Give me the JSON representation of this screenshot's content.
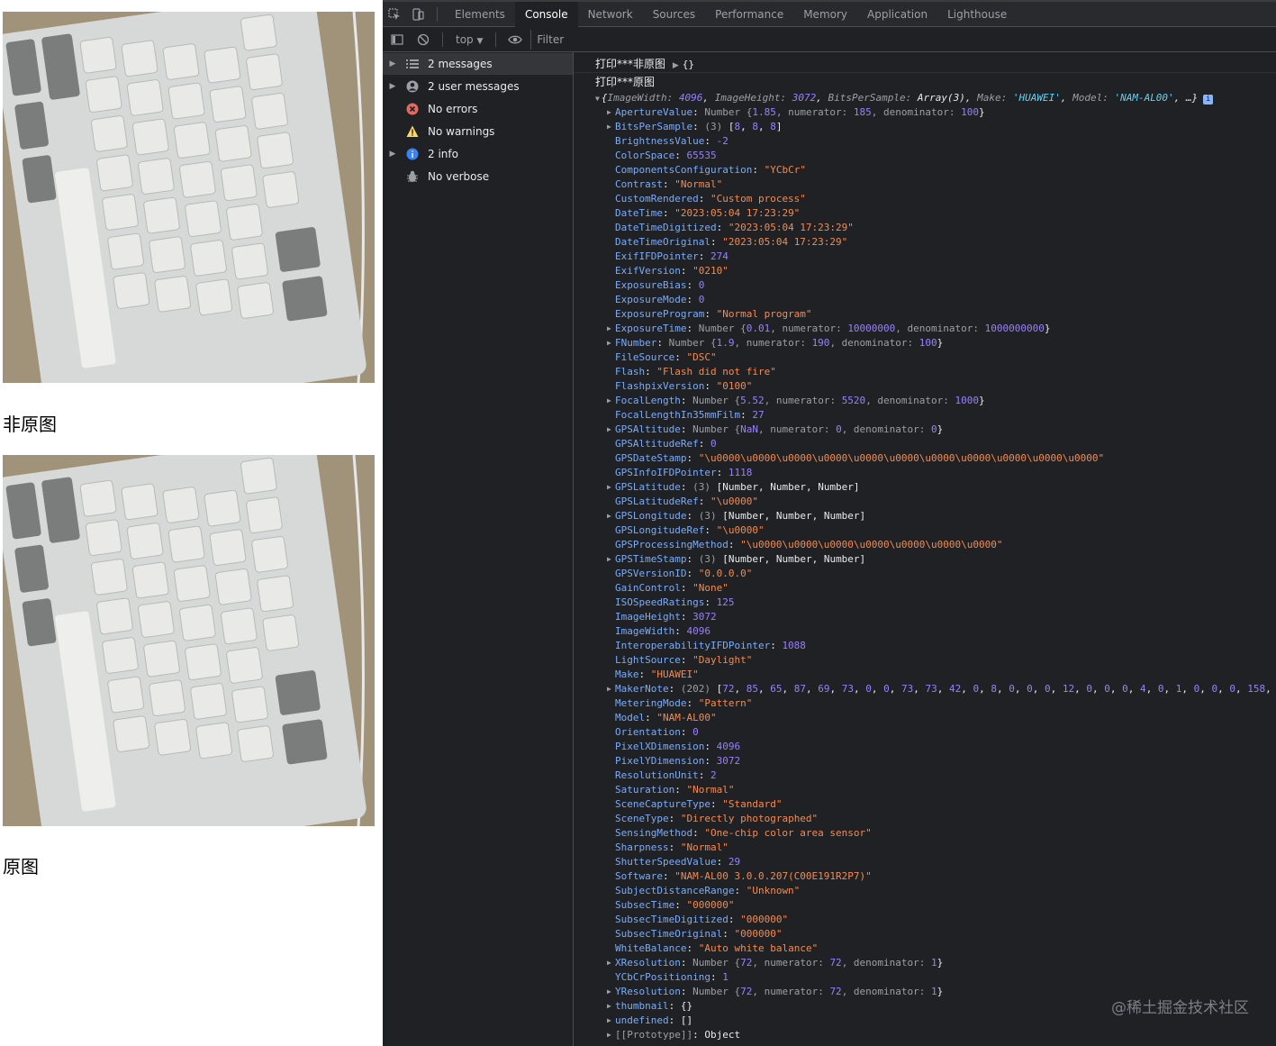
{
  "captions": {
    "modified": "非原图",
    "original": "原图"
  },
  "devtools": {
    "tabs": [
      "Elements",
      "Console",
      "Network",
      "Sources",
      "Performance",
      "Memory",
      "Application",
      "Lighthouse"
    ],
    "active_tab": "Console",
    "toolbar": {
      "context": "top",
      "filter_placeholder": "Filter"
    },
    "sidebar": [
      {
        "label": "2 messages",
        "icon": "list-icon",
        "expandable": true,
        "selected": true
      },
      {
        "label": "2 user messages",
        "icon": "user-icon",
        "expandable": true
      },
      {
        "label": "No errors",
        "icon": "error-icon",
        "expandable": false
      },
      {
        "label": "No warnings",
        "icon": "warning-icon",
        "expandable": false
      },
      {
        "label": "2 info",
        "icon": "info-icon",
        "expandable": true
      },
      {
        "label": "No verbose",
        "icon": "verbose-icon",
        "expandable": false
      }
    ],
    "logs": {
      "first": {
        "text": "打印***非原图",
        "value": "{}"
      },
      "second": {
        "text": "打印***原图"
      }
    },
    "object_summary": {
      "open": "{",
      "pairs": [
        {
          "key": "ImageWidth",
          "value": "4096",
          "kind": "num"
        },
        {
          "key": "ImageHeight",
          "value": "3072",
          "kind": "num"
        },
        {
          "key": "BitsPerSample",
          "value": "Array(3)",
          "kind": "kw"
        },
        {
          "key": "Make",
          "value": "'HUAWEI'",
          "kind": "strS"
        },
        {
          "key": "Model",
          "value": "'NAM-AL00'",
          "kind": "strS"
        }
      ],
      "close": "…}"
    },
    "properties": [
      {
        "key": "ApertureValue",
        "exp": true,
        "parts": [
          [
            "Number {",
            "gray"
          ],
          [
            "1.85",
            "num"
          ],
          [
            ", numerator: ",
            "gray"
          ],
          [
            "185",
            "num"
          ],
          [
            ", denominator: ",
            "gray"
          ],
          [
            "100",
            "num"
          ],
          [
            "}",
            "kw"
          ]
        ]
      },
      {
        "key": "BitsPerSample",
        "exp": true,
        "parts": [
          [
            "(3) ",
            "gray"
          ],
          [
            "[",
            "kw"
          ],
          [
            "8",
            "num"
          ],
          [
            ", ",
            "kw"
          ],
          [
            "8",
            "num"
          ],
          [
            ", ",
            "kw"
          ],
          [
            "8",
            "num"
          ],
          [
            "]",
            "kw"
          ]
        ]
      },
      {
        "key": "BrightnessValue",
        "parts": [
          [
            "-2",
            "num"
          ]
        ]
      },
      {
        "key": "ColorSpace",
        "parts": [
          [
            "65535",
            "num"
          ]
        ]
      },
      {
        "key": "ComponentsConfiguration",
        "parts": [
          [
            "\"YCbCr\"",
            "str"
          ]
        ]
      },
      {
        "key": "Contrast",
        "parts": [
          [
            "\"Normal\"",
            "str"
          ]
        ]
      },
      {
        "key": "CustomRendered",
        "parts": [
          [
            "\"Custom process\"",
            "str"
          ]
        ]
      },
      {
        "key": "DateTime",
        "parts": [
          [
            "\"2023:05:04 17:23:29\"",
            "str"
          ]
        ]
      },
      {
        "key": "DateTimeDigitized",
        "parts": [
          [
            "\"2023:05:04 17:23:29\"",
            "str"
          ]
        ]
      },
      {
        "key": "DateTimeOriginal",
        "parts": [
          [
            "\"2023:05:04 17:23:29\"",
            "str"
          ]
        ]
      },
      {
        "key": "ExifIFDPointer",
        "parts": [
          [
            "274",
            "num"
          ]
        ]
      },
      {
        "key": "ExifVersion",
        "parts": [
          [
            "\"0210\"",
            "str"
          ]
        ]
      },
      {
        "key": "ExposureBias",
        "parts": [
          [
            "0",
            "num"
          ]
        ]
      },
      {
        "key": "ExposureMode",
        "parts": [
          [
            "0",
            "num"
          ]
        ]
      },
      {
        "key": "ExposureProgram",
        "parts": [
          [
            "\"Normal program\"",
            "str"
          ]
        ]
      },
      {
        "key": "ExposureTime",
        "exp": true,
        "parts": [
          [
            "Number {",
            "gray"
          ],
          [
            "0.01",
            "num"
          ],
          [
            ", numerator: ",
            "gray"
          ],
          [
            "10000000",
            "num"
          ],
          [
            ", denominator: ",
            "gray"
          ],
          [
            "1000000000",
            "num"
          ],
          [
            "}",
            "kw"
          ]
        ]
      },
      {
        "key": "FNumber",
        "exp": true,
        "parts": [
          [
            "Number {",
            "gray"
          ],
          [
            "1.9",
            "num"
          ],
          [
            ", numerator: ",
            "gray"
          ],
          [
            "190",
            "num"
          ],
          [
            ", denominator: ",
            "gray"
          ],
          [
            "100",
            "num"
          ],
          [
            "}",
            "kw"
          ]
        ]
      },
      {
        "key": "FileSource",
        "parts": [
          [
            "\"DSC\"",
            "str"
          ]
        ]
      },
      {
        "key": "Flash",
        "parts": [
          [
            "\"Flash did not fire\"",
            "str"
          ]
        ]
      },
      {
        "key": "FlashpixVersion",
        "parts": [
          [
            "\"0100\"",
            "str"
          ]
        ]
      },
      {
        "key": "FocalLength",
        "exp": true,
        "parts": [
          [
            "Number {",
            "gray"
          ],
          [
            "5.52",
            "num"
          ],
          [
            ", numerator: ",
            "gray"
          ],
          [
            "5520",
            "num"
          ],
          [
            ", denominator: ",
            "gray"
          ],
          [
            "1000",
            "num"
          ],
          [
            "}",
            "kw"
          ]
        ]
      },
      {
        "key": "FocalLengthIn35mmFilm",
        "parts": [
          [
            "27",
            "num"
          ]
        ]
      },
      {
        "key": "GPSAltitude",
        "exp": true,
        "parts": [
          [
            "Number {",
            "gray"
          ],
          [
            "NaN",
            "num"
          ],
          [
            ", numerator: ",
            "gray"
          ],
          [
            "0",
            "num"
          ],
          [
            ", denominator: ",
            "gray"
          ],
          [
            "0",
            "num"
          ],
          [
            "}",
            "kw"
          ]
        ]
      },
      {
        "key": "GPSAltitudeRef",
        "parts": [
          [
            "0",
            "num"
          ]
        ]
      },
      {
        "key": "GPSDateStamp",
        "parts": [
          [
            "\"\\u0000\\u0000\\u0000\\u0000\\u0000\\u0000\\u0000\\u0000\\u0000\\u0000\\u0000\"",
            "str"
          ]
        ]
      },
      {
        "key": "GPSInfoIFDPointer",
        "parts": [
          [
            "1118",
            "num"
          ]
        ]
      },
      {
        "key": "GPSLatitude",
        "exp": true,
        "parts": [
          [
            "(3) ",
            "gray"
          ],
          [
            "[Number, Number, Number]",
            "kw"
          ]
        ]
      },
      {
        "key": "GPSLatitudeRef",
        "parts": [
          [
            "\"\\u0000\"",
            "str"
          ]
        ]
      },
      {
        "key": "GPSLongitude",
        "exp": true,
        "parts": [
          [
            "(3) ",
            "gray"
          ],
          [
            "[Number, Number, Number]",
            "kw"
          ]
        ]
      },
      {
        "key": "GPSLongitudeRef",
        "parts": [
          [
            "\"\\u0000\"",
            "str"
          ]
        ]
      },
      {
        "key": "GPSProcessingMethod",
        "parts": [
          [
            "\"\\u0000\\u0000\\u0000\\u0000\\u0000\\u0000\\u0000\"",
            "str"
          ]
        ]
      },
      {
        "key": "GPSTimeStamp",
        "exp": true,
        "parts": [
          [
            "(3) ",
            "gray"
          ],
          [
            "[Number, Number, Number]",
            "kw"
          ]
        ]
      },
      {
        "key": "GPSVersionID",
        "parts": [
          [
            "\"0.0.0.0\"",
            "str"
          ]
        ]
      },
      {
        "key": "GainControl",
        "parts": [
          [
            "\"None\"",
            "str"
          ]
        ]
      },
      {
        "key": "ISOSpeedRatings",
        "parts": [
          [
            "125",
            "num"
          ]
        ]
      },
      {
        "key": "ImageHeight",
        "parts": [
          [
            "3072",
            "num"
          ]
        ]
      },
      {
        "key": "ImageWidth",
        "parts": [
          [
            "4096",
            "num"
          ]
        ]
      },
      {
        "key": "InteroperabilityIFDPointer",
        "parts": [
          [
            "1088",
            "num"
          ]
        ]
      },
      {
        "key": "LightSource",
        "parts": [
          [
            "\"Daylight\"",
            "str"
          ]
        ]
      },
      {
        "key": "Make",
        "parts": [
          [
            "\"HUAWEI\"",
            "str"
          ]
        ]
      },
      {
        "key": "MakerNote",
        "exp": true,
        "parts": [
          [
            "(202) ",
            "gray"
          ],
          [
            "[",
            "kw"
          ],
          [
            "72",
            "num"
          ],
          [
            ", ",
            "kw"
          ],
          [
            "85",
            "num"
          ],
          [
            ", ",
            "kw"
          ],
          [
            "65",
            "num"
          ],
          [
            ", ",
            "kw"
          ],
          [
            "87",
            "num"
          ],
          [
            ", ",
            "kw"
          ],
          [
            "69",
            "num"
          ],
          [
            ", ",
            "kw"
          ],
          [
            "73",
            "num"
          ],
          [
            ", ",
            "kw"
          ],
          [
            "0",
            "num"
          ],
          [
            ", ",
            "kw"
          ],
          [
            "0",
            "num"
          ],
          [
            ", ",
            "kw"
          ],
          [
            "73",
            "num"
          ],
          [
            ", ",
            "kw"
          ],
          [
            "73",
            "num"
          ],
          [
            ", ",
            "kw"
          ],
          [
            "42",
            "num"
          ],
          [
            ", ",
            "kw"
          ],
          [
            "0",
            "num"
          ],
          [
            ", ",
            "kw"
          ],
          [
            "8",
            "num"
          ],
          [
            ", ",
            "kw"
          ],
          [
            "0",
            "num"
          ],
          [
            ", ",
            "kw"
          ],
          [
            "0",
            "num"
          ],
          [
            ", ",
            "kw"
          ],
          [
            "0",
            "num"
          ],
          [
            ", ",
            "kw"
          ],
          [
            "12",
            "num"
          ],
          [
            ", ",
            "kw"
          ],
          [
            "0",
            "num"
          ],
          [
            ", ",
            "kw"
          ],
          [
            "0",
            "num"
          ],
          [
            ", ",
            "kw"
          ],
          [
            "0",
            "num"
          ],
          [
            ", ",
            "kw"
          ],
          [
            "4",
            "num"
          ],
          [
            ", ",
            "kw"
          ],
          [
            "0",
            "num"
          ],
          [
            ", ",
            "kw"
          ],
          [
            "1",
            "num"
          ],
          [
            ", ",
            "kw"
          ],
          [
            "0",
            "num"
          ],
          [
            ", ",
            "kw"
          ],
          [
            "0",
            "num"
          ],
          [
            ", ",
            "kw"
          ],
          [
            "0",
            "num"
          ],
          [
            ", ",
            "kw"
          ],
          [
            "158",
            "num"
          ],
          [
            ",",
            "kw"
          ]
        ]
      },
      {
        "key": "MeteringMode",
        "parts": [
          [
            "\"Pattern\"",
            "str"
          ]
        ]
      },
      {
        "key": "Model",
        "parts": [
          [
            "\"NAM-AL00\"",
            "str"
          ]
        ]
      },
      {
        "key": "Orientation",
        "parts": [
          [
            "0",
            "num"
          ]
        ]
      },
      {
        "key": "PixelXDimension",
        "parts": [
          [
            "4096",
            "num"
          ]
        ]
      },
      {
        "key": "PixelYDimension",
        "parts": [
          [
            "3072",
            "num"
          ]
        ]
      },
      {
        "key": "ResolutionUnit",
        "parts": [
          [
            "2",
            "num"
          ]
        ]
      },
      {
        "key": "Saturation",
        "parts": [
          [
            "\"Normal\"",
            "str"
          ]
        ]
      },
      {
        "key": "SceneCaptureType",
        "parts": [
          [
            "\"Standard\"",
            "str"
          ]
        ]
      },
      {
        "key": "SceneType",
        "parts": [
          [
            "\"Directly photographed\"",
            "str"
          ]
        ]
      },
      {
        "key": "SensingMethod",
        "parts": [
          [
            "\"One-chip color area sensor\"",
            "str"
          ]
        ]
      },
      {
        "key": "Sharpness",
        "parts": [
          [
            "\"Normal\"",
            "str"
          ]
        ]
      },
      {
        "key": "ShutterSpeedValue",
        "parts": [
          [
            "29",
            "num"
          ]
        ]
      },
      {
        "key": "Software",
        "parts": [
          [
            "\"NAM-AL00 3.0.0.207(C00E191R2P7)\"",
            "str"
          ]
        ]
      },
      {
        "key": "SubjectDistanceRange",
        "parts": [
          [
            "\"Unknown\"",
            "str"
          ]
        ]
      },
      {
        "key": "SubsecTime",
        "parts": [
          [
            "\"000000\"",
            "str"
          ]
        ]
      },
      {
        "key": "SubsecTimeDigitized",
        "parts": [
          [
            "\"000000\"",
            "str"
          ]
        ]
      },
      {
        "key": "SubsecTimeOriginal",
        "parts": [
          [
            "\"000000\"",
            "str"
          ]
        ]
      },
      {
        "key": "WhiteBalance",
        "parts": [
          [
            "\"Auto white balance\"",
            "str"
          ]
        ]
      },
      {
        "key": "XResolution",
        "exp": true,
        "parts": [
          [
            "Number {",
            "gray"
          ],
          [
            "72",
            "num"
          ],
          [
            ", numerator: ",
            "gray"
          ],
          [
            "72",
            "num"
          ],
          [
            ", denominator: ",
            "gray"
          ],
          [
            "1",
            "num"
          ],
          [
            "}",
            "kw"
          ]
        ]
      },
      {
        "key": "YCbCrPositioning",
        "parts": [
          [
            "1",
            "num"
          ]
        ]
      },
      {
        "key": "YResolution",
        "exp": true,
        "parts": [
          [
            "Number {",
            "gray"
          ],
          [
            "72",
            "num"
          ],
          [
            ", numerator: ",
            "gray"
          ],
          [
            "72",
            "num"
          ],
          [
            ", denominator: ",
            "gray"
          ],
          [
            "1",
            "num"
          ],
          [
            "}",
            "kw"
          ]
        ]
      },
      {
        "key": "thumbnail",
        "exp": true,
        "parts": [
          [
            "{}",
            "kw"
          ]
        ]
      },
      {
        "key": "undefined",
        "exp": true,
        "parts": [
          [
            "[]",
            "kw"
          ]
        ]
      },
      {
        "key": "[[Prototype]]",
        "exp": true,
        "proto": true,
        "parts": [
          [
            "Object",
            "kw"
          ]
        ]
      }
    ]
  },
  "watermark": "@稀土掘金技术社区"
}
